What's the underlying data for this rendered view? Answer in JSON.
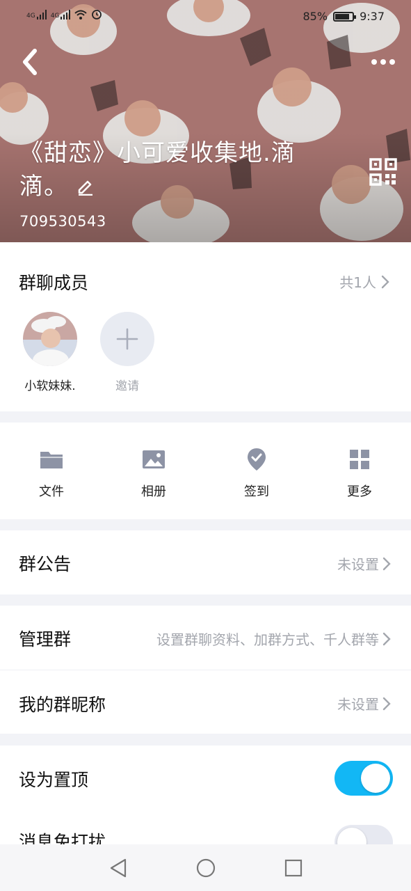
{
  "status_bar": {
    "signal_1": "4G",
    "signal_2": "4G",
    "battery_percent": "85%",
    "battery_level": 0.85,
    "time": "9:37"
  },
  "header": {
    "title": "《甜恋》小可爱收集地.滴滴。",
    "group_id": "709530543",
    "background_color": "#b07a76"
  },
  "members": {
    "title": "群聊成员",
    "count_label": "共1人",
    "list": [
      {
        "name": "小软妹妹."
      }
    ],
    "invite_label": "邀请"
  },
  "tools": [
    {
      "label": "文件",
      "icon": "folder-icon"
    },
    {
      "label": "相册",
      "icon": "album-icon"
    },
    {
      "label": "签到",
      "icon": "check-in-icon"
    },
    {
      "label": "更多",
      "icon": "grid-more-icon"
    }
  ],
  "notice": {
    "title": "群公告",
    "value": "未设置"
  },
  "manage": {
    "title": "管理群",
    "value": "设置群聊资料、加群方式、千人群等"
  },
  "nickname": {
    "title": "我的群昵称",
    "value": "未设置"
  },
  "settings": {
    "pin_label": "设为置顶",
    "pin_on": true,
    "dnd_label": "消息免打扰",
    "dnd_on": false
  },
  "colors": {
    "accent": "#12b7f5",
    "secondary_text": "#a3a6ad",
    "icon": "#8d93a5"
  }
}
